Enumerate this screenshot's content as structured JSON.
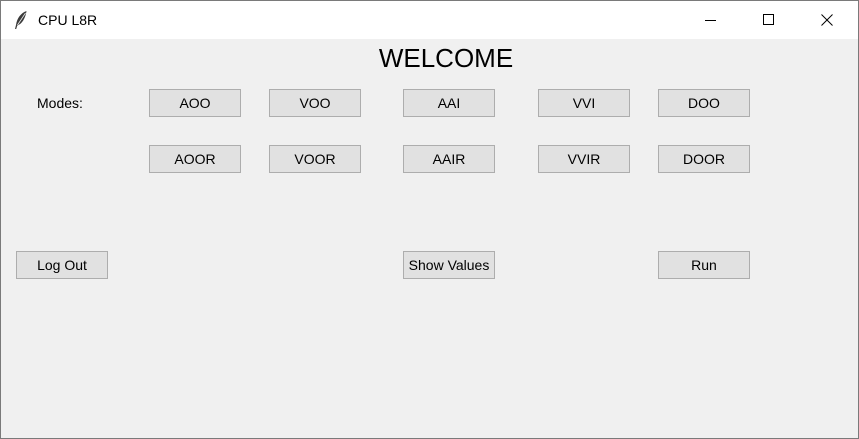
{
  "window": {
    "title": "CPU L8R",
    "app_icon": "feather-icon",
    "controls": {
      "minimize_icon": "minimize-icon",
      "maximize_icon": "maximize-icon",
      "close_icon": "close-icon"
    }
  },
  "main": {
    "heading": "WELCOME",
    "modes_label": "Modes:",
    "modes_row1": [
      "AOO",
      "VOO",
      "AAI",
      "VVI",
      "DOO"
    ],
    "modes_row2": [
      "AOOR",
      "VOOR",
      "AAIR",
      "VVIR",
      "DOOR"
    ],
    "actions": {
      "logout": "Log Out",
      "show_values": "Show Values",
      "run": "Run"
    }
  },
  "colors": {
    "background": "#f0f0f0",
    "button_face": "#e1e1e1",
    "button_border": "#adadad",
    "titlebar": "#ffffff"
  }
}
